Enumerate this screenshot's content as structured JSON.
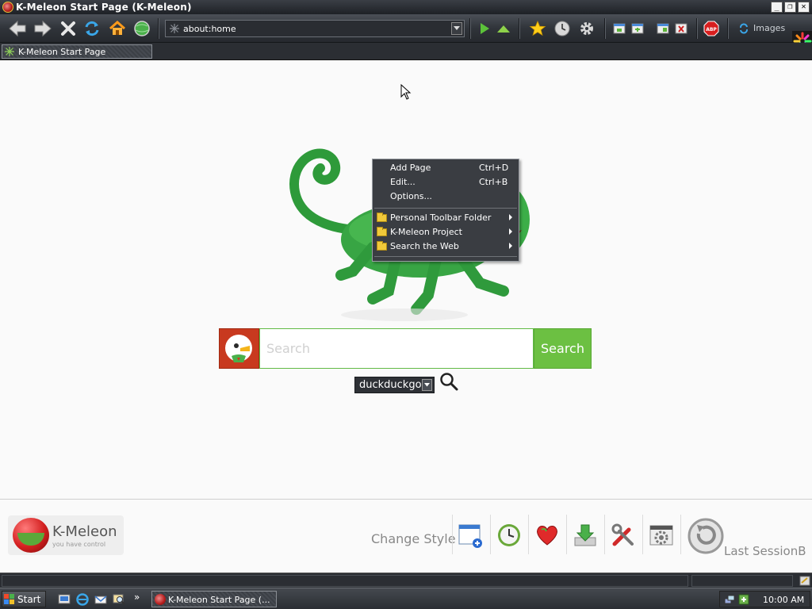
{
  "window": {
    "title": "K-Meleon Start Page (K-Meleon)",
    "controls": {
      "minimize": "_",
      "restore": "❐",
      "close": "✕"
    }
  },
  "toolbar": {
    "buttons": [
      "back-icon",
      "forward-icon",
      "stop-icon",
      "reload-icon",
      "home-icon",
      "globe-icon",
      "go-icon",
      "up-icon",
      "bookmarks-star-icon",
      "history-clock-icon",
      "preferences-gear-icon",
      "window-icon",
      "window-icon",
      "window-icon",
      "close-window-icon",
      "adblock-icon"
    ],
    "url": "about:home",
    "images_label": "Images"
  },
  "tabs": [
    {
      "label": "K-Meleon Start Page"
    }
  ],
  "context_menu": {
    "items": [
      {
        "label": "Add Page",
        "shortcut": "Ctrl+D"
      },
      {
        "label": "Edit...",
        "shortcut": "Ctrl+B"
      },
      {
        "label": "Options..."
      }
    ],
    "folders": [
      {
        "label": "Personal Toolbar Folder"
      },
      {
        "label": "K-Meleon Project"
      },
      {
        "label": "Search the Web"
      }
    ]
  },
  "search": {
    "placeholder": "Search",
    "button_label": "Search",
    "engine": "duckduckgo"
  },
  "footer": {
    "logo_name": "K-Meleon",
    "logo_tagline": "you have control",
    "change_style": "Change Style",
    "last_session": "Last SessionB",
    "tools": [
      "new-window-icon",
      "history-icon",
      "favorites-heart-icon",
      "downloads-icon",
      "tools-icon",
      "settings-icon"
    ]
  },
  "taskbar": {
    "start_label": "Start",
    "quick_launch_more": "»",
    "task_label": "K-Meleon Start Page (...",
    "clock": "10:00 AM"
  },
  "colors": {
    "toolbar_bg": "#30343a",
    "search_green": "#6cc042",
    "ddg_red": "#c8391f",
    "page_bg": "#fafafa"
  }
}
